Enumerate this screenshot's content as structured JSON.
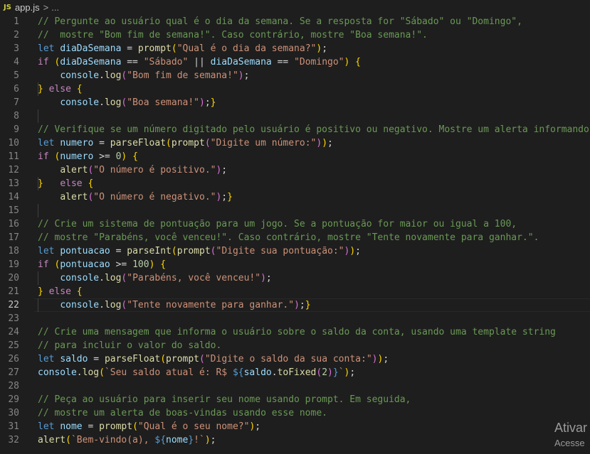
{
  "breadcrumb": {
    "file_icon": "JS",
    "file": "app.js",
    "separator": ">",
    "more": "..."
  },
  "active_line": 22,
  "lines": [
    {
      "n": "1",
      "tokens": [
        [
          "cm",
          "// Pergunte ao usuário qual é o dia da semana. Se a resposta for \"Sábado\" ou \"Domingo\","
        ]
      ]
    },
    {
      "n": "2",
      "tokens": [
        [
          "cm",
          "//  mostre \"Bom fim de semana!\". Caso contrário, mostre \"Boa semana!\"."
        ]
      ]
    },
    {
      "n": "3",
      "tokens": [
        [
          "kw",
          "let"
        ],
        [
          "op",
          " "
        ],
        [
          "vr",
          "diaDaSemana"
        ],
        [
          "op",
          " = "
        ],
        [
          "fn",
          "prompt"
        ],
        [
          "p1",
          "("
        ],
        [
          "st",
          "\"Qual é o dia da semana?\""
        ],
        [
          "p1",
          ")"
        ],
        [
          "op",
          ";"
        ]
      ]
    },
    {
      "n": "4",
      "tokens": [
        [
          "ct",
          "if"
        ],
        [
          "op",
          " "
        ],
        [
          "p1",
          "("
        ],
        [
          "vr",
          "diaDaSemana"
        ],
        [
          "op",
          " == "
        ],
        [
          "st",
          "\"Sábado\""
        ],
        [
          "op",
          " || "
        ],
        [
          "vr",
          "diaDaSemana"
        ],
        [
          "op",
          " == "
        ],
        [
          "st",
          "\"Domingo\""
        ],
        [
          "p1",
          ")"
        ],
        [
          "op",
          " "
        ],
        [
          "p1",
          "{"
        ]
      ]
    },
    {
      "n": "5",
      "tokens": [
        [
          "op",
          "    "
        ],
        [
          "vr",
          "console"
        ],
        [
          "op",
          "."
        ],
        [
          "fn",
          "log"
        ],
        [
          "p2",
          "("
        ],
        [
          "st",
          "\"Bom fim de semana!\""
        ],
        [
          "p2",
          ")"
        ],
        [
          "op",
          ";"
        ]
      ]
    },
    {
      "n": "6",
      "tokens": [
        [
          "p1",
          "}"
        ],
        [
          "op",
          " "
        ],
        [
          "ct",
          "else"
        ],
        [
          "op",
          " "
        ],
        [
          "p1",
          "{"
        ]
      ]
    },
    {
      "n": "7",
      "tokens": [
        [
          "op",
          "    "
        ],
        [
          "vr",
          "console"
        ],
        [
          "op",
          "."
        ],
        [
          "fn",
          "log"
        ],
        [
          "p2",
          "("
        ],
        [
          "st",
          "\"Boa semana!\""
        ],
        [
          "p2",
          ")"
        ],
        [
          "op",
          ";"
        ],
        [
          "p1",
          "}"
        ]
      ]
    },
    {
      "n": "8",
      "tokens": []
    },
    {
      "n": "9",
      "tokens": [
        [
          "cm",
          "// Verifique se um número digitado pelo usuário é positivo ou negativo. Mostre um alerta informando."
        ]
      ]
    },
    {
      "n": "10",
      "tokens": [
        [
          "kw",
          "let"
        ],
        [
          "op",
          " "
        ],
        [
          "vr",
          "numero"
        ],
        [
          "op",
          " = "
        ],
        [
          "fn",
          "parseFloat"
        ],
        [
          "p1",
          "("
        ],
        [
          "fn",
          "prompt"
        ],
        [
          "p2",
          "("
        ],
        [
          "st",
          "\"Digite um número:\""
        ],
        [
          "p2",
          ")"
        ],
        [
          "p1",
          ")"
        ],
        [
          "op",
          ";"
        ]
      ]
    },
    {
      "n": "11",
      "tokens": [
        [
          "ct",
          "if"
        ],
        [
          "op",
          " "
        ],
        [
          "p1",
          "("
        ],
        [
          "vr",
          "numero"
        ],
        [
          "op",
          " >= "
        ],
        [
          "nm",
          "0"
        ],
        [
          "p1",
          ")"
        ],
        [
          "op",
          " "
        ],
        [
          "p1",
          "{"
        ]
      ]
    },
    {
      "n": "12",
      "tokens": [
        [
          "op",
          "    "
        ],
        [
          "fn",
          "alert"
        ],
        [
          "p2",
          "("
        ],
        [
          "st",
          "\"O número é positivo.\""
        ],
        [
          "p2",
          ")"
        ],
        [
          "op",
          ";"
        ]
      ]
    },
    {
      "n": "13",
      "tokens": [
        [
          "p1",
          "}"
        ],
        [
          "op",
          "   "
        ],
        [
          "ct",
          "else"
        ],
        [
          "op",
          " "
        ],
        [
          "p1",
          "{"
        ]
      ]
    },
    {
      "n": "14",
      "tokens": [
        [
          "op",
          "    "
        ],
        [
          "fn",
          "alert"
        ],
        [
          "p2",
          "("
        ],
        [
          "st",
          "\"O número é negativo.\""
        ],
        [
          "p2",
          ")"
        ],
        [
          "op",
          ";"
        ],
        [
          "p1",
          "}"
        ]
      ]
    },
    {
      "n": "15",
      "tokens": []
    },
    {
      "n": "16",
      "tokens": [
        [
          "cm",
          "// Crie um sistema de pontuação para um jogo. Se a pontuação for maior ou igual a 100,"
        ]
      ]
    },
    {
      "n": "17",
      "tokens": [
        [
          "cm",
          "// mostre \"Parabéns, você venceu!\". Caso contrário, mostre \"Tente novamente para ganhar.\"."
        ]
      ]
    },
    {
      "n": "18",
      "tokens": [
        [
          "kw",
          "let"
        ],
        [
          "op",
          " "
        ],
        [
          "vr",
          "pontuacao"
        ],
        [
          "op",
          " = "
        ],
        [
          "fn",
          "parseInt"
        ],
        [
          "p1",
          "("
        ],
        [
          "fn",
          "prompt"
        ],
        [
          "p2",
          "("
        ],
        [
          "st",
          "\"Digite sua pontuação:\""
        ],
        [
          "p2",
          ")"
        ],
        [
          "p1",
          ")"
        ],
        [
          "op",
          ";"
        ]
      ]
    },
    {
      "n": "19",
      "tokens": [
        [
          "ct",
          "if"
        ],
        [
          "op",
          " "
        ],
        [
          "p1",
          "("
        ],
        [
          "vr",
          "pontuacao"
        ],
        [
          "op",
          " >= "
        ],
        [
          "nm",
          "100"
        ],
        [
          "p1",
          ")"
        ],
        [
          "op",
          " "
        ],
        [
          "p1",
          "{"
        ]
      ]
    },
    {
      "n": "20",
      "tokens": [
        [
          "op",
          "    "
        ],
        [
          "vr",
          "console"
        ],
        [
          "op",
          "."
        ],
        [
          "fn",
          "log"
        ],
        [
          "p2",
          "("
        ],
        [
          "st",
          "\"Parabéns, você venceu!\""
        ],
        [
          "p2",
          ")"
        ],
        [
          "op",
          ";"
        ]
      ]
    },
    {
      "n": "21",
      "tokens": [
        [
          "p1",
          "}"
        ],
        [
          "op",
          " "
        ],
        [
          "ct",
          "else"
        ],
        [
          "op",
          " "
        ],
        [
          "p1",
          "{"
        ]
      ]
    },
    {
      "n": "22",
      "tokens": [
        [
          "op",
          "    "
        ],
        [
          "vr",
          "console"
        ],
        [
          "op",
          "."
        ],
        [
          "fn",
          "log"
        ],
        [
          "p2",
          "("
        ],
        [
          "st",
          "\"Tente novamente para ganhar.\""
        ],
        [
          "p2",
          ")"
        ],
        [
          "op",
          ";"
        ],
        [
          "p1",
          "}"
        ]
      ]
    },
    {
      "n": "23",
      "tokens": []
    },
    {
      "n": "24",
      "tokens": [
        [
          "cm",
          "// Crie uma mensagem que informa o usuário sobre o saldo da conta, usando uma template string"
        ]
      ]
    },
    {
      "n": "25",
      "tokens": [
        [
          "cm",
          "// para incluir o valor do saldo."
        ]
      ]
    },
    {
      "n": "26",
      "tokens": [
        [
          "kw",
          "let"
        ],
        [
          "op",
          " "
        ],
        [
          "vr",
          "saldo"
        ],
        [
          "op",
          " = "
        ],
        [
          "fn",
          "parseFloat"
        ],
        [
          "p1",
          "("
        ],
        [
          "fn",
          "prompt"
        ],
        [
          "p2",
          "("
        ],
        [
          "st",
          "\"Digite o saldo da sua conta:\""
        ],
        [
          "p2",
          ")"
        ],
        [
          "p1",
          ")"
        ],
        [
          "op",
          ";"
        ]
      ]
    },
    {
      "n": "27",
      "tokens": [
        [
          "vr",
          "console"
        ],
        [
          "op",
          "."
        ],
        [
          "fn",
          "log"
        ],
        [
          "p1",
          "("
        ],
        [
          "st",
          "`Seu saldo atual é: R$ "
        ],
        [
          "kw",
          "${"
        ],
        [
          "vr",
          "saldo"
        ],
        [
          "op",
          "."
        ],
        [
          "fn",
          "toFixed"
        ],
        [
          "p2",
          "("
        ],
        [
          "nm",
          "2"
        ],
        [
          "p2",
          ")"
        ],
        [
          "kw",
          "}"
        ],
        [
          "st",
          "`"
        ],
        [
          "p1",
          ")"
        ],
        [
          "op",
          ";"
        ]
      ]
    },
    {
      "n": "28",
      "tokens": []
    },
    {
      "n": "29",
      "tokens": [
        [
          "cm",
          "// Peça ao usuário para inserir seu nome usando prompt. Em seguida,"
        ]
      ]
    },
    {
      "n": "30",
      "tokens": [
        [
          "cm",
          "// mostre um alerta de boas-vindas usando esse nome."
        ]
      ]
    },
    {
      "n": "31",
      "tokens": [
        [
          "kw",
          "let"
        ],
        [
          "op",
          " "
        ],
        [
          "vr",
          "nome"
        ],
        [
          "op",
          " = "
        ],
        [
          "fn",
          "prompt"
        ],
        [
          "p1",
          "("
        ],
        [
          "st",
          "\"Qual é o seu nome?\""
        ],
        [
          "p1",
          ")"
        ],
        [
          "op",
          ";"
        ]
      ]
    },
    {
      "n": "32",
      "tokens": [
        [
          "fn",
          "alert"
        ],
        [
          "p1",
          "("
        ],
        [
          "st",
          "`Bem-vindo(a), "
        ],
        [
          "kw",
          "${"
        ],
        [
          "vr",
          "nome"
        ],
        [
          "kw",
          "}"
        ],
        [
          "st",
          "!`"
        ],
        [
          "p1",
          ")"
        ],
        [
          "op",
          ";"
        ]
      ]
    }
  ],
  "watermark": {
    "line1": "Ativar",
    "line2": "Acesse"
  }
}
